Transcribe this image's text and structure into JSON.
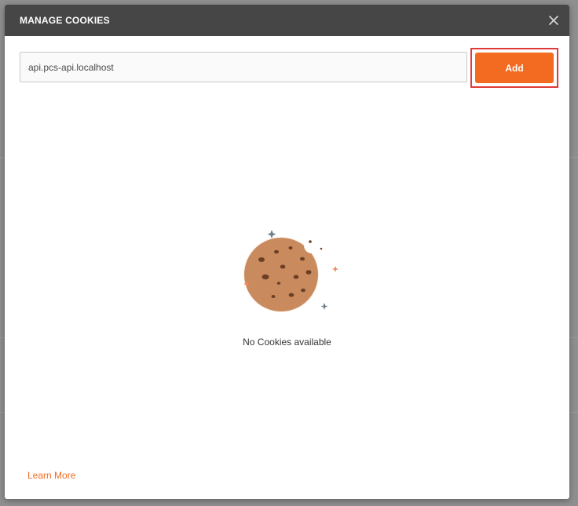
{
  "modal": {
    "title": "MANAGE COOKIES",
    "close_icon": "close-icon"
  },
  "domain_input": {
    "value": "api.pcs-api.localhost",
    "placeholder": ""
  },
  "add_button": {
    "label": "Add"
  },
  "empty_state": {
    "icon": "cookie-icon",
    "message": "No Cookies available"
  },
  "footer": {
    "learn_more": "Learn More"
  },
  "colors": {
    "header_bg": "#464646",
    "accent": "#f26b21",
    "cookie": "#c98a5e",
    "highlight": "#e03a3a"
  }
}
